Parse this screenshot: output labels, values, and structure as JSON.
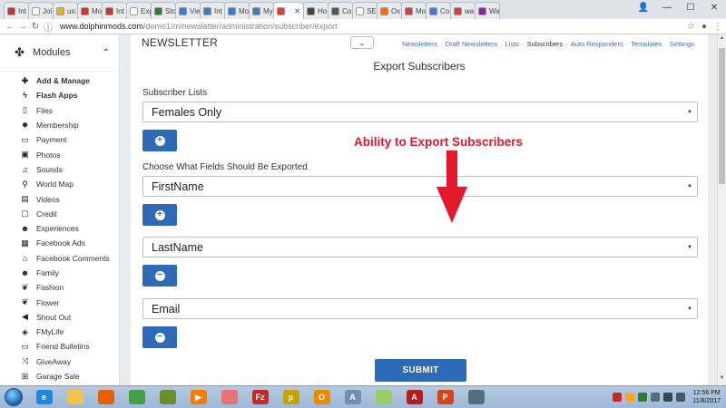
{
  "browser": {
    "tabs": [
      {
        "label": "Int",
        "color": "#d93025"
      },
      {
        "label": "Joi",
        "color": "#ffffff"
      },
      {
        "label": "us:",
        "color": "#f4b400"
      },
      {
        "label": "Mo",
        "color": "#d93025"
      },
      {
        "label": "Int",
        "color": "#d93025"
      },
      {
        "label": "Exp",
        "color": "#ffffff"
      },
      {
        "label": "Sto",
        "color": "#2e7d32"
      },
      {
        "label": "Vie",
        "color": "#3a7bd5"
      },
      {
        "label": "Int",
        "color": "#3a7bd5"
      },
      {
        "label": "Mo",
        "color": "#3a7bd5"
      },
      {
        "label": "My",
        "color": "#3a7bd5"
      },
      {
        "label": "",
        "color": "#e53935",
        "active": true
      },
      {
        "label": "Ho",
        "color": "#444444"
      },
      {
        "label": "Co",
        "color": "#555555"
      },
      {
        "label": "SE",
        "color": "#ffffff"
      },
      {
        "label": "Ox",
        "color": "#ff6d00"
      },
      {
        "label": "Mo",
        "color": "#e53935"
      },
      {
        "label": "Co",
        "color": "#3a7bd5"
      },
      {
        "label": "wa",
        "color": "#e53935"
      },
      {
        "label": "Wa",
        "color": "#8e24aa"
      }
    ],
    "url_host": "www.dolphinmods.com",
    "url_path": "/demo1/m/newsletter/administration/subscriber/export"
  },
  "sidebar": {
    "title": "Modules",
    "items": [
      {
        "label": "Add & Manage",
        "icon": "plus-icon",
        "glyph": "✚",
        "bold": true
      },
      {
        "label": "Flash Apps",
        "icon": "flash-icon",
        "glyph": "ϟ",
        "bold": true
      },
      {
        "label": "Files",
        "icon": "file-icon",
        "glyph": "▯"
      },
      {
        "label": "Membership",
        "icon": "badge-icon",
        "glyph": "✸"
      },
      {
        "label": "Payment",
        "icon": "credit-card-icon",
        "glyph": "▭"
      },
      {
        "label": "Photos",
        "icon": "photo-icon",
        "glyph": "▣"
      },
      {
        "label": "Sounds",
        "icon": "music-icon",
        "glyph": "♫"
      },
      {
        "label": "World Map",
        "icon": "map-marker-icon",
        "glyph": "⚲"
      },
      {
        "label": "Videos",
        "icon": "film-icon",
        "glyph": "▤"
      },
      {
        "label": "Credit",
        "icon": "credit-icon",
        "glyph": "▢"
      },
      {
        "label": "Experiences",
        "icon": "users-icon",
        "glyph": "☻"
      },
      {
        "label": "Facebook Ads",
        "icon": "ad-icon",
        "glyph": "▦"
      },
      {
        "label": "Facebook Comments",
        "icon": "home-icon",
        "glyph": "⌂"
      },
      {
        "label": "Family",
        "icon": "family-icon",
        "glyph": "☻"
      },
      {
        "label": "Fashion",
        "icon": "leaf-icon",
        "glyph": "❦"
      },
      {
        "label": "Flower",
        "icon": "leaf-icon",
        "glyph": "❦"
      },
      {
        "label": "Shout Out",
        "icon": "megaphone-icon",
        "glyph": "◀"
      },
      {
        "label": "FMyLife",
        "icon": "tag-icon",
        "glyph": "◈"
      },
      {
        "label": "Friend Bulletins",
        "icon": "bulletin-icon",
        "glyph": "▭"
      },
      {
        "label": "GiveAway",
        "icon": "shuffle-icon",
        "glyph": "⤨"
      },
      {
        "label": "Garage Sale",
        "icon": "cart-icon",
        "glyph": "⊞"
      }
    ]
  },
  "main": {
    "section_title": "NEWSLETTER",
    "nav": [
      "Newsletters",
      "Draft Newsletters",
      "Lists",
      "Subscribers",
      "Auto Responders",
      "Templates",
      "Settings"
    ],
    "nav_current": "Subscribers",
    "page_title": "Export Subscribers",
    "lists_label": "Subscriber Lists",
    "lists_value": "Females Only",
    "fields_label": "Choose What Fields Should Be Exported",
    "fields": [
      "FirstName",
      "LastName",
      "Email"
    ],
    "submit_label": "SUBMIT",
    "annotation": "Ability to Export Subscribers"
  },
  "taskbar": {
    "apps": [
      {
        "icon": "ie-icon",
        "glyph": "e",
        "color": "#1e88e5"
      },
      {
        "icon": "folder-icon",
        "glyph": "",
        "color": "#f2c14e"
      },
      {
        "icon": "firefox-icon",
        "glyph": "",
        "color": "#e66000"
      },
      {
        "icon": "chrome-icon",
        "glyph": "",
        "color": "#43a047"
      },
      {
        "icon": "frog-icon",
        "glyph": "",
        "color": "#6a8f2a"
      },
      {
        "icon": "media-player-icon",
        "glyph": "▶",
        "color": "#f57c00"
      },
      {
        "icon": "eraser-icon",
        "glyph": "",
        "color": "#e57373"
      },
      {
        "icon": "filezilla-icon",
        "glyph": "Fz",
        "color": "#c62828"
      },
      {
        "icon": "utorrent-icon",
        "glyph": "µ",
        "color": "#c8a200"
      },
      {
        "icon": "outlook-icon",
        "glyph": "O",
        "color": "#ef8a00"
      },
      {
        "icon": "font-icon",
        "glyph": "A",
        "color": "#6d8fb8"
      },
      {
        "icon": "paint-icon",
        "glyph": "",
        "color": "#9ccc65"
      },
      {
        "icon": "acrobat-icon",
        "glyph": "A",
        "color": "#b71c1c"
      },
      {
        "icon": "powerpoint-icon",
        "glyph": "P",
        "color": "#d84315"
      },
      {
        "icon": "snipping-icon",
        "glyph": "",
        "color": "#546e7a"
      }
    ],
    "time": "12:56 PM",
    "date": "11/8/2017"
  }
}
